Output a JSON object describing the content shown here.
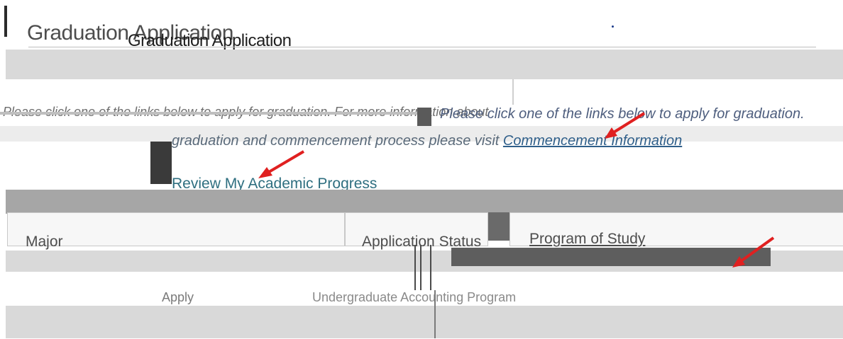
{
  "page": {
    "title": "Graduation Application",
    "title_overlay": "Graduation Application"
  },
  "intro": {
    "left_text": "Please click one of the links below to apply for graduation. For more information about",
    "right_text": "Please click one of the links below to apply for graduation.",
    "second_line_text": "graduation and commencement process please visit",
    "commencement_link_label": "Commencement Information"
  },
  "review_link": {
    "label": "Review My Academic Progress"
  },
  "table": {
    "headers": {
      "major": "Major",
      "application_status": "Application Status",
      "program_of_study": "Program of Study"
    },
    "row": {
      "left_text": "Apply",
      "right_text": "Undergraduate Accounting Program"
    }
  },
  "colors": {
    "arrow": "#e02020",
    "link": "#2f6f80"
  },
  "icons": {
    "arrow_1": "red-arrow-icon",
    "arrow_2": "red-arrow-icon",
    "arrow_3": "red-arrow-icon"
  }
}
